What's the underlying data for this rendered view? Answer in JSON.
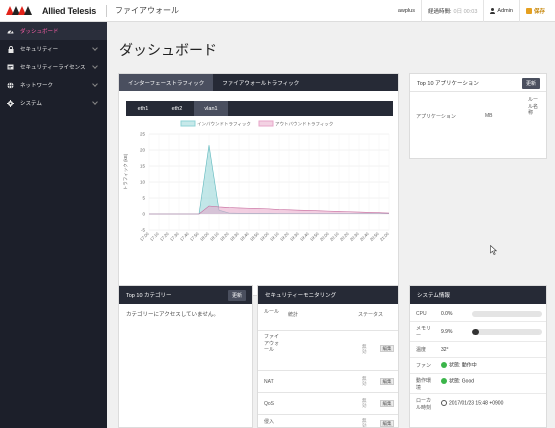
{
  "brand": {
    "name": "Allied Telesis",
    "app_title": "ファイアウォール"
  },
  "header": {
    "host": "awplus",
    "timer_label": "経過時間:",
    "timer_value": "0日 00:03",
    "user": "Admin",
    "save_label": "保存"
  },
  "sidebar": {
    "items": [
      {
        "label": "ダッシュボード",
        "icon": "dashboard-icon",
        "active": true
      },
      {
        "label": "セキュリティー",
        "icon": "lock-icon"
      },
      {
        "label": "セキュリティーライセンス",
        "icon": "license-icon"
      },
      {
        "label": "ネットワーク",
        "icon": "globe-icon"
      },
      {
        "label": "システム",
        "icon": "gear-icon"
      }
    ]
  },
  "page": {
    "title": "ダッシュボード"
  },
  "traffic": {
    "tabs": [
      "インターフェーストラフィック",
      "ファイアウォールトラフィック"
    ],
    "interfaces": [
      "eth1",
      "eth2",
      "vlan1"
    ]
  },
  "chart_data": {
    "type": "area",
    "legend": [
      "インバウンドトラフィック",
      "アウトバウンドトラフィック"
    ],
    "legend_position": "top",
    "ylabel": "トラフィック (kB)",
    "ylim": [
      -5,
      25
    ],
    "yticks": [
      25,
      20,
      15,
      10,
      5,
      0,
      -5
    ],
    "categories": [
      "17:00",
      "17:10",
      "17:20",
      "17:30",
      "17:40",
      "17:50",
      "18:00",
      "18:10",
      "18:20",
      "18:30",
      "18:40",
      "18:50",
      "19:00",
      "19:10",
      "19:20",
      "19:30",
      "19:40",
      "19:50",
      "20:00",
      "20:10",
      "20:20",
      "20:30",
      "20:40",
      "20:50",
      "21:00"
    ],
    "series": [
      {
        "name": "インバウンドトラフィック",
        "color": "#8fd3d6",
        "values": [
          0,
          0,
          0,
          0,
          0,
          0,
          21.5,
          1.2,
          0.3,
          0.2,
          0.2,
          0.2,
          0.2,
          0.1,
          0.1,
          0.1,
          0.1,
          0.1,
          0.1,
          0.1,
          0.1,
          0.1,
          0.1,
          0.1,
          0.1
        ]
      },
      {
        "name": "アウトバウンドトラフィック",
        "color": "#e7a6c8",
        "values": [
          0,
          0,
          0,
          0,
          0,
          0,
          2.5,
          2.2,
          2.0,
          1.9,
          1.8,
          1.7,
          1.6,
          1.4,
          1.3,
          1.2,
          1.1,
          1.0,
          0.9,
          0.8,
          0.7,
          0.6,
          0.5,
          0.4,
          0.3
        ]
      }
    ],
    "grid": true
  },
  "apps": {
    "title": "Top 10 アプリケーション",
    "update": "更新",
    "col_app": "アプリケーション",
    "col_mb": "MB",
    "col_rule": "ルール名称"
  },
  "category": {
    "title": "Top 10 カテゴリー",
    "update": "更新",
    "message": "カテゴリーにアクセスしていません。"
  },
  "security": {
    "title": "セキュリティーモニタリング",
    "col_rule": "ルール",
    "col_stats": "統計",
    "col_status": "ステータス",
    "rows": [
      {
        "rule": "ファイアウォール",
        "status": "無効",
        "action": "編集"
      },
      {
        "rule": "NAT",
        "status": "無効",
        "action": "編集"
      },
      {
        "rule": "QoS",
        "status": "無効",
        "action": "編集"
      },
      {
        "rule": "侵入",
        "status": "無効",
        "action": "編集"
      }
    ]
  },
  "system": {
    "title": "システム情報",
    "cpu_label": "CPU",
    "cpu_value": "0.0%",
    "cpu_level": 0.0,
    "mem_label": "メモリー",
    "mem_value": "9.9%",
    "mem_level": 0.099,
    "temp_label": "温度",
    "temp_value": "32°",
    "fan_label": "ファン",
    "fan_value": "状態: 動作中",
    "psu_label": "動作環境",
    "psu_value": "状態: Good",
    "time_label": "ローカル時刻",
    "time_value": "2017/01/23 15:48 +0900"
  }
}
